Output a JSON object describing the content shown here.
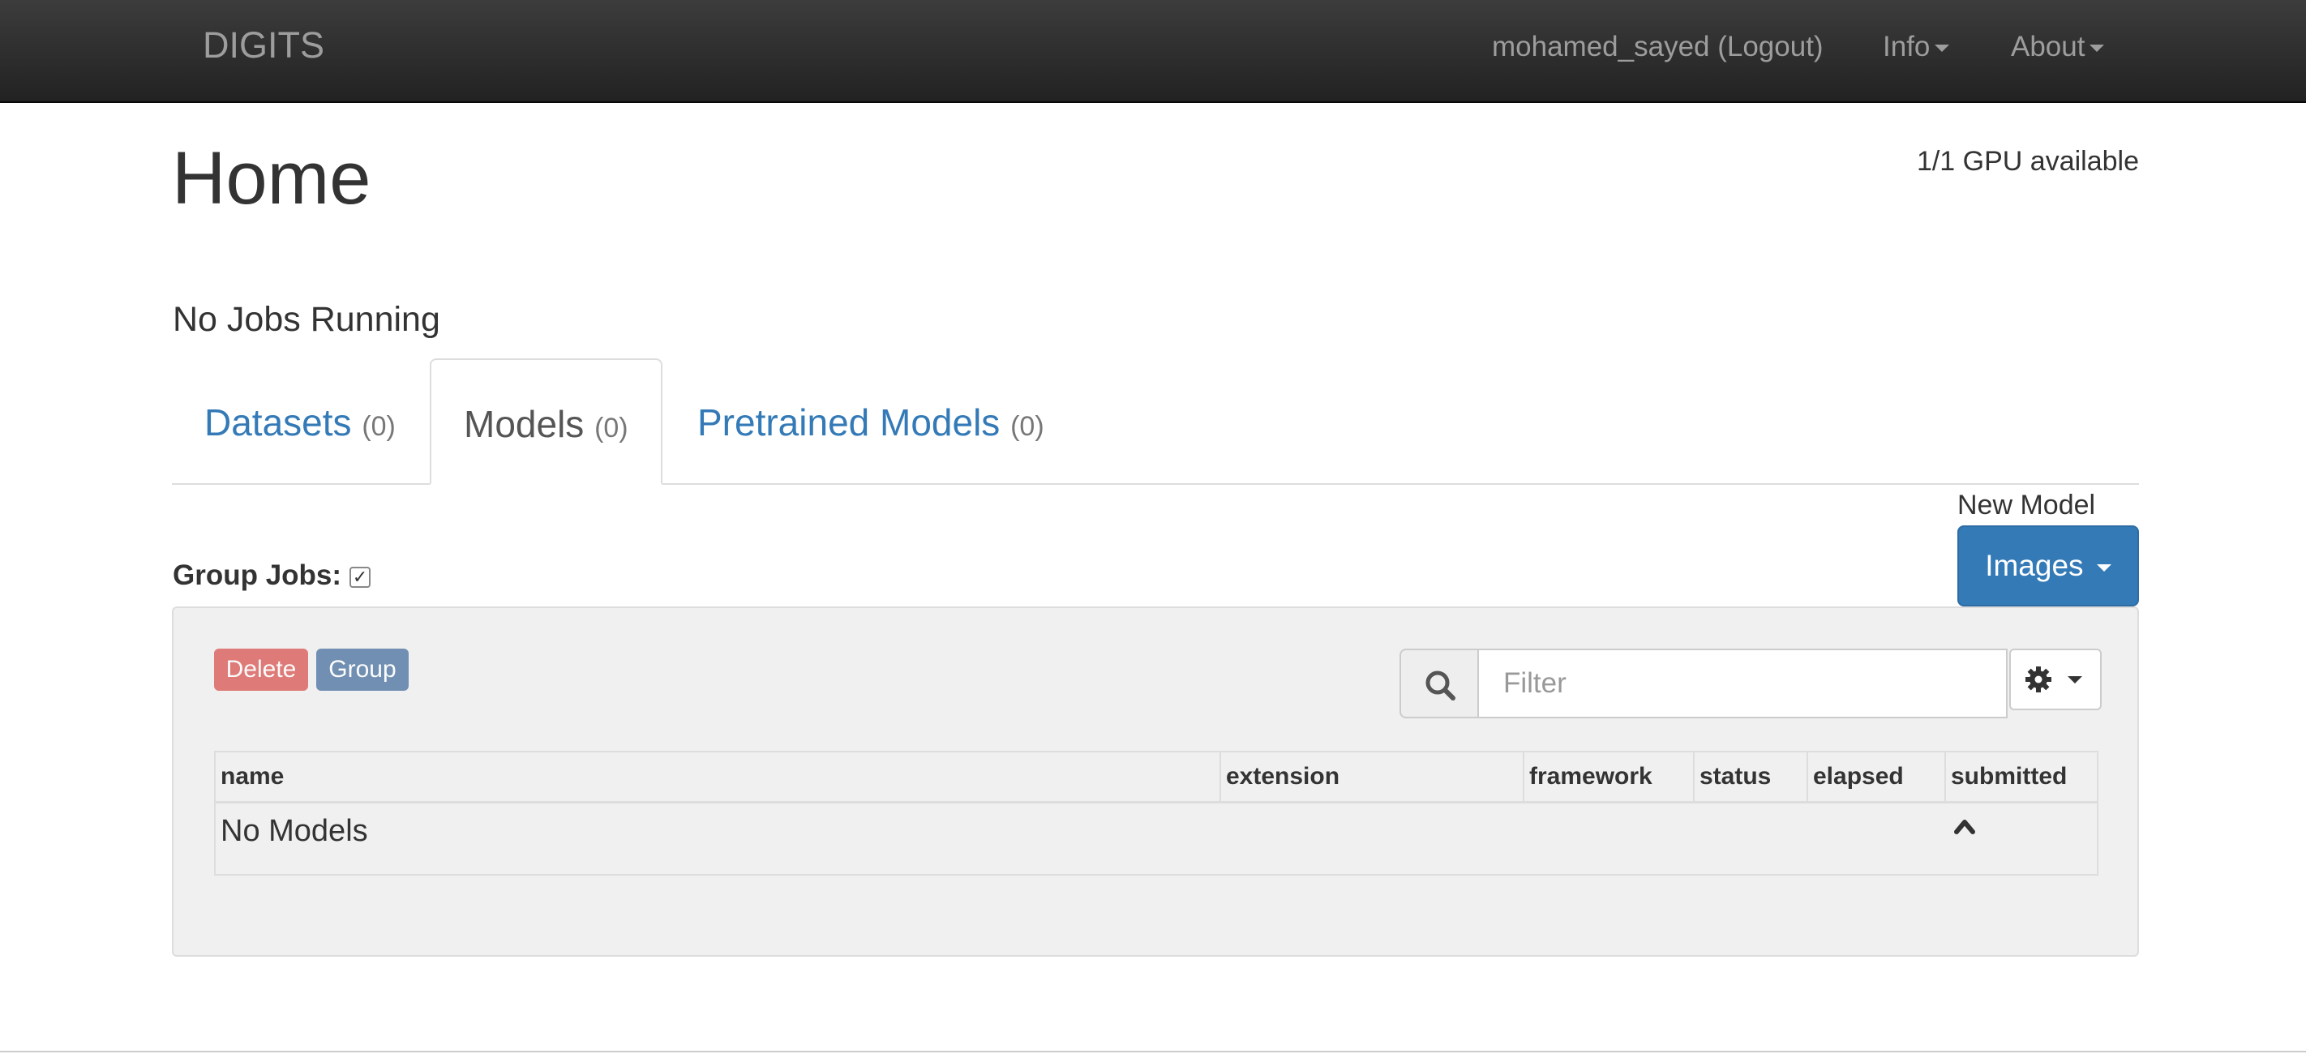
{
  "navbar": {
    "brand": "DIGITS",
    "user": "mohamed_sayed (Logout)",
    "info": "Info",
    "about": "About"
  },
  "header": {
    "title": "Home",
    "gpu_status": "1/1 GPU available",
    "jobs_status": "No Jobs Running"
  },
  "tabs": [
    {
      "label": "Datasets",
      "count": "(0)",
      "active": false
    },
    {
      "label": "Models",
      "count": "(0)",
      "active": true
    },
    {
      "label": "Pretrained Models",
      "count": "(0)",
      "active": false
    }
  ],
  "group_jobs": {
    "label": "Group Jobs:",
    "checked": true
  },
  "new_model": {
    "label": "New Model",
    "button": "Images"
  },
  "panel": {
    "delete_label": "Delete",
    "group_label": "Group",
    "filter_placeholder": "Filter",
    "table": {
      "columns": [
        "name",
        "extension",
        "framework",
        "status",
        "elapsed",
        "submitted"
      ],
      "empty_text": "No Models"
    }
  },
  "icons": {
    "search": "search-icon",
    "gear": "gear-icon",
    "sort": "sort-up-icon",
    "caret": "caret-down-icon"
  },
  "colors": {
    "navbar": "#222222",
    "link": "#337ab7",
    "primary": "#337ab7",
    "danger": "#d9534f",
    "panel": "#f0f0f0"
  }
}
